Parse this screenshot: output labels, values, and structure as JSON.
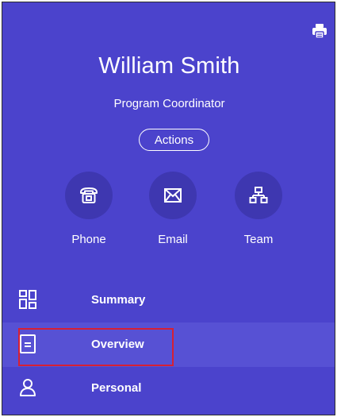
{
  "profile": {
    "name": "William Smith",
    "title": "Program Coordinator",
    "actions_label": "Actions"
  },
  "toolbar": {
    "print_icon": "printer-icon"
  },
  "contacts": [
    {
      "label": "Phone",
      "icon": "phone-icon"
    },
    {
      "label": "Email",
      "icon": "envelope-icon"
    },
    {
      "label": "Team",
      "icon": "org-chart-icon"
    }
  ],
  "nav": {
    "items": [
      {
        "label": "Summary",
        "icon": "grid-icon",
        "selected": false
      },
      {
        "label": "Overview",
        "icon": "document-icon",
        "selected": true
      },
      {
        "label": "Personal",
        "icon": "person-icon",
        "selected": false
      }
    ]
  },
  "colors": {
    "panel_background": "#4b43cc",
    "contact_circle": "#3e37b0",
    "selected_row": "#5751d4",
    "highlight_border": "#d62035",
    "text": "#ffffff"
  }
}
